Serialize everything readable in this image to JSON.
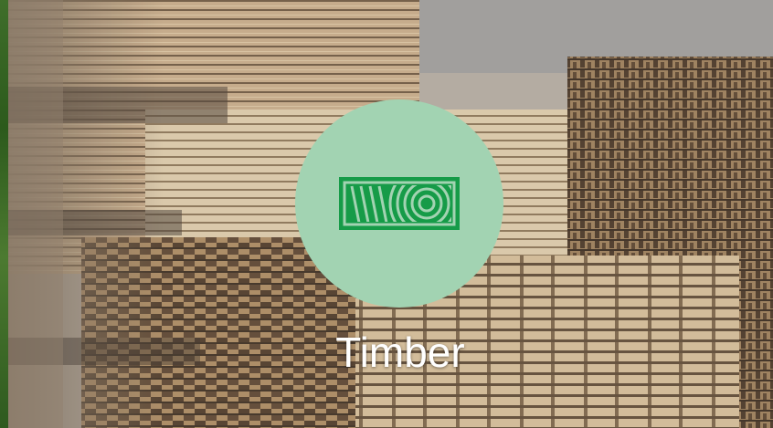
{
  "tile": {
    "title": "Timber",
    "icon": "timber-wood-grain-icon"
  },
  "colors": {
    "badge": "#a2d3b2",
    "icon": "#169b48",
    "label": "#ffffff"
  }
}
